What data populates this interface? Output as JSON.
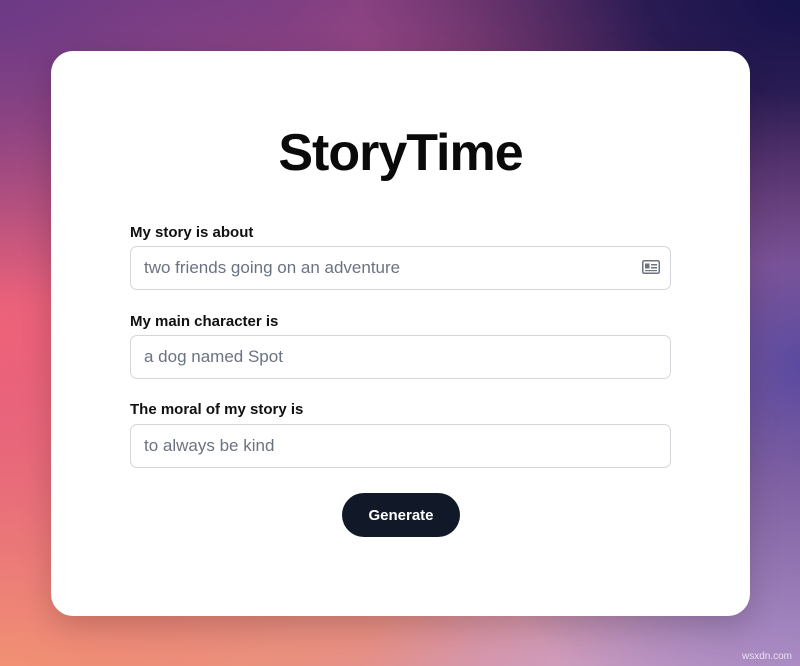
{
  "app": {
    "title": "StoryTime"
  },
  "form": {
    "fields": [
      {
        "label": "My story is about",
        "value": "",
        "placeholder": "two friends going on an adventure"
      },
      {
        "label": "My main character is",
        "value": "",
        "placeholder": "a dog named Spot"
      },
      {
        "label": "The moral of my story is",
        "value": "",
        "placeholder": "to always be kind"
      }
    ],
    "autofill_icon": "contact-card-icon",
    "submit_label": "Generate"
  },
  "watermark": "wsxdn.com",
  "colors": {
    "button_bg": "#111827",
    "button_text": "#ffffff",
    "card_bg": "#ffffff",
    "placeholder": "#6b7280"
  }
}
